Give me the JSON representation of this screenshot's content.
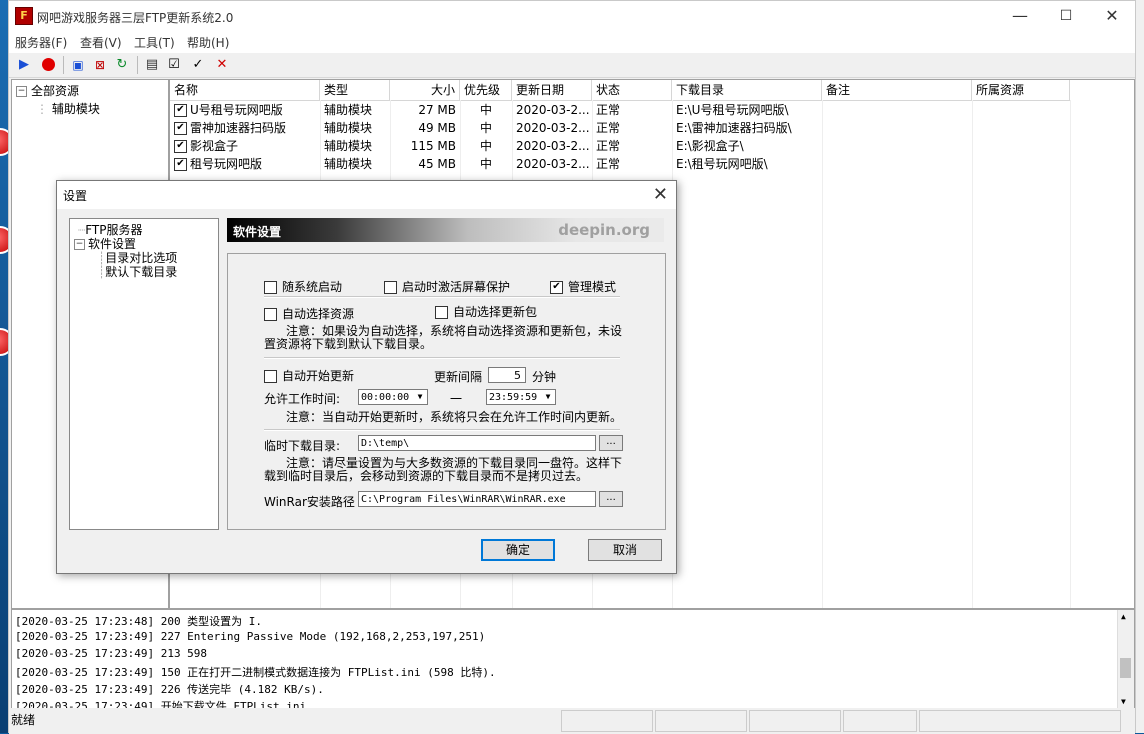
{
  "app": {
    "title": "网吧游戏服务器三层FTP更新系统2.0",
    "minimize": "—",
    "maximize": "☐",
    "close": "✕"
  },
  "menu": [
    "服务器(F)",
    "查看(V)",
    "工具(T)",
    "帮助(H)"
  ],
  "toolbar_icons": [
    "play-icon",
    "record-icon",
    "connect-icon",
    "delete-icon",
    "refresh-icon",
    "settings-icon",
    "check-icon",
    "task-icon",
    "remove-icon"
  ],
  "tree": {
    "root": "全部资源",
    "child": "辅助模块"
  },
  "list": {
    "columns": [
      "名称",
      "类型",
      "大小",
      "优先级",
      "更新日期",
      "状态",
      "下载目录",
      "备注",
      "所属资源"
    ],
    "rows": [
      {
        "name": "U号租号玩网吧版",
        "type": "辅助模块",
        "size": "27 MB",
        "priority": "中",
        "date": "2020-03-2...",
        "status": "正常",
        "dir": "E:\\U号租号玩网吧版\\",
        "checked": "✔"
      },
      {
        "name": "雷神加速器扫码版",
        "type": "辅助模块",
        "size": "49 MB",
        "priority": "中",
        "date": "2020-03-2...",
        "status": "正常",
        "dir": "E:\\雷神加速器扫码版\\",
        "checked": "✔"
      },
      {
        "name": "影视盒子",
        "type": "辅助模块",
        "size": "115 MB",
        "priority": "中",
        "date": "2020-03-2...",
        "status": "正常",
        "dir": "E:\\影视盒子\\",
        "checked": "✔"
      },
      {
        "name": "租号玩网吧版",
        "type": "辅助模块",
        "size": "45 MB",
        "priority": "中",
        "date": "2020-03-2...",
        "status": "正常",
        "dir": "E:\\租号玩网吧版\\",
        "checked": "✔"
      }
    ]
  },
  "log": [
    "[2020-03-25 17:23:48] 200 类型设置为 I.",
    "[2020-03-25 17:23:49] 227 Entering Passive Mode (192,168,2,253,197,251)",
    "[2020-03-25 17:23:49] 213 598",
    "[2020-03-25 17:23:49] 150 正在打开二进制模式数据连接为 FTPList.ini (598 比特).",
    "[2020-03-25 17:23:49] 226 传送完毕 (4.182 KB/s).",
    "[2020-03-25 17:23:49] 开始下载文件 FTPList.ini"
  ],
  "status": "就绪",
  "dialog": {
    "title": "设置",
    "close": "✕",
    "tree": {
      "ftp": "FTP服务器",
      "software": "软件设置",
      "compare": "目录对比选项",
      "default_dir": "默认下载目录"
    },
    "banner_title": "软件设置",
    "banner_logo": "deepin.org",
    "opt_autostart": "随系统启动",
    "opt_screensaver": "启动时激活屏幕保护",
    "opt_admin": "管理模式",
    "admin_checked": "✔",
    "opt_auto_resource": "自动选择资源",
    "opt_auto_update_pkg": "自动选择更新包",
    "note1_line1": "注意：如果设为自动选择，系统将自动选择资源和更新包，未设",
    "note1_line2": "置资源将下载到默认下载目录。",
    "opt_auto_update": "自动开始更新",
    "interval_label": "更新间隔",
    "interval_value": "5",
    "interval_unit": "分钟",
    "work_time_label": "允许工作时间:",
    "time_start": "00:00:00",
    "time_dash": "一",
    "time_end": "23:59:59",
    "note2": "注意：当自动开始更新时，系统将只会在允许工作时间内更新。",
    "temp_dir_label": "临时下载目录:",
    "temp_dir_value": "D:\\temp\\",
    "note3_line1": "注意：请尽量设置为与大多数资源的下载目录同一盘符。这样下",
    "note3_line2": "载到临时目录后，会移动到资源的下载目录而不是拷贝过去。",
    "winrar_label": "WinRar安装路径",
    "winrar_value": "C:\\Program Files\\WinRAR\\WinRAR.exe",
    "browse": "...",
    "ok": "确定",
    "cancel": "取消"
  },
  "colors": {
    "accent": "#0078d7",
    "play": "#1a4fd6",
    "record": "#e00000"
  }
}
